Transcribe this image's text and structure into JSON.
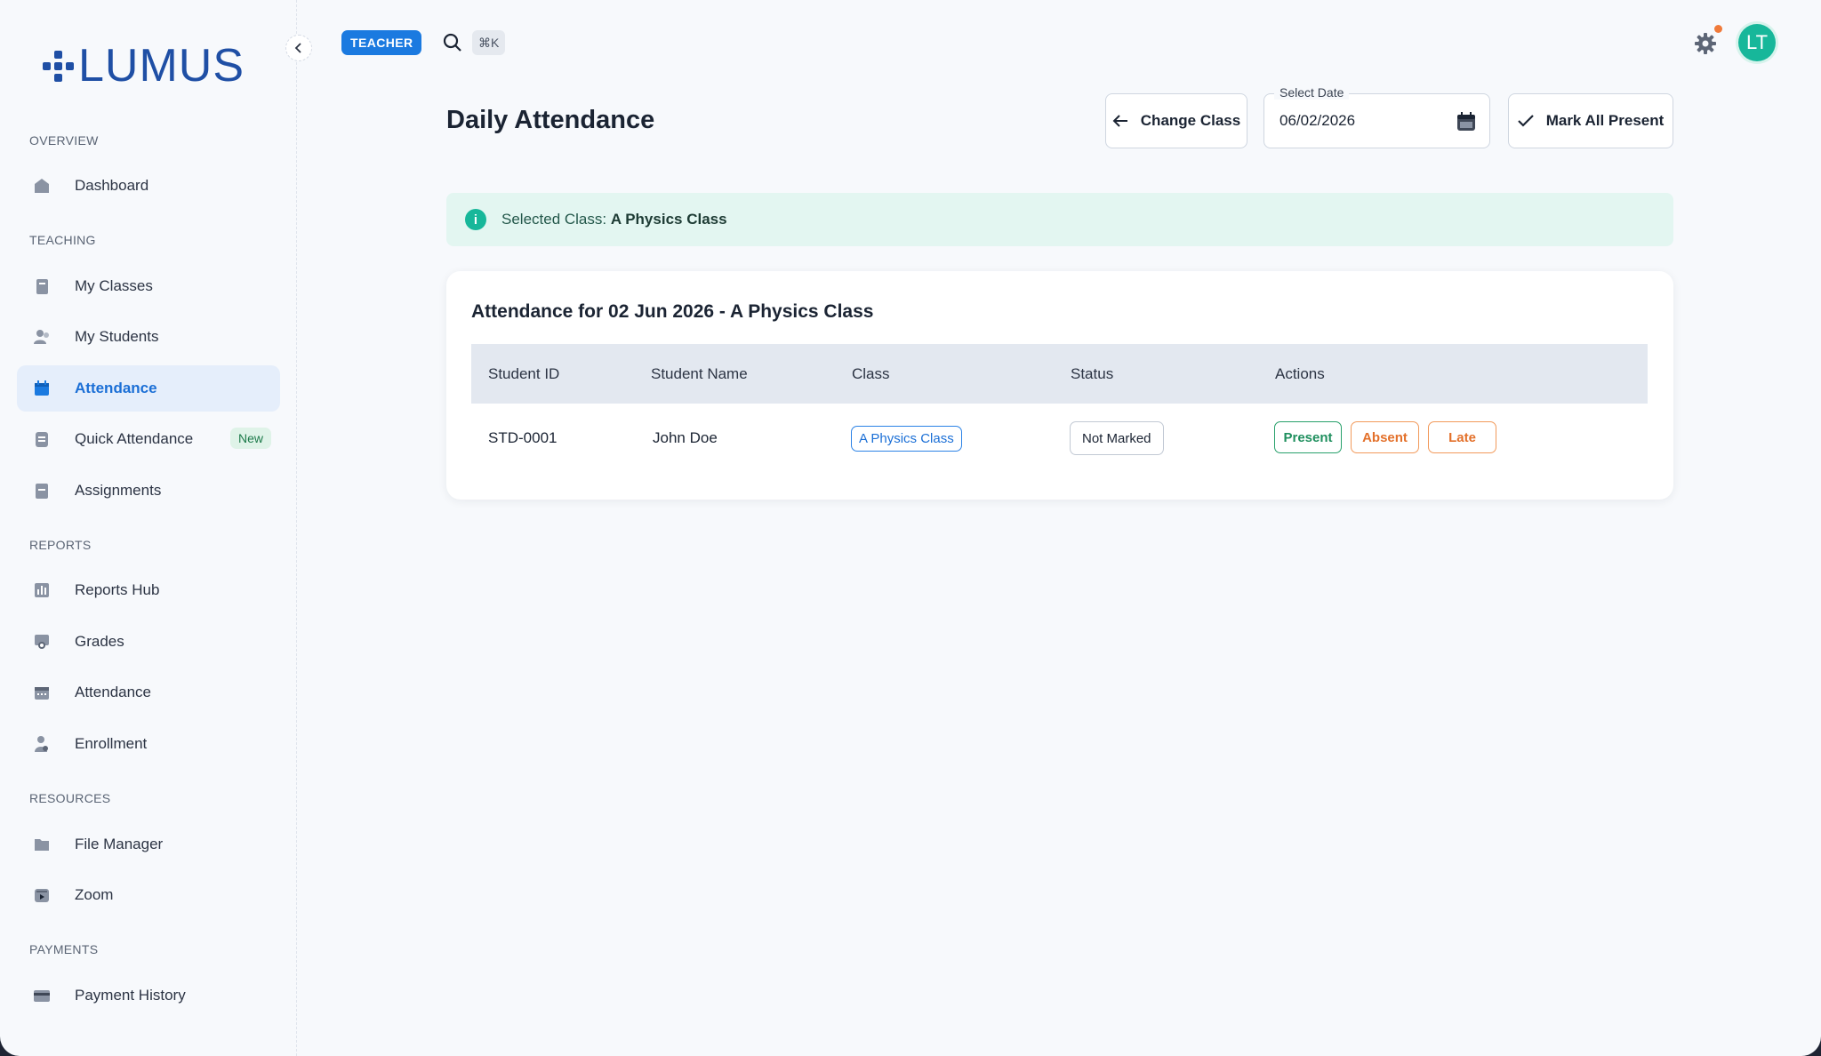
{
  "brand": {
    "name": "LUMUS"
  },
  "topbar": {
    "role_badge": "TEACHER",
    "shortcut": "⌘K",
    "avatar_initials": "LT"
  },
  "sidebar": {
    "sections": [
      {
        "label": "OVERVIEW",
        "items": [
          {
            "label": "Dashboard",
            "icon": "home-icon"
          }
        ]
      },
      {
        "label": "TEACHING",
        "items": [
          {
            "label": "My Classes",
            "icon": "book-icon"
          },
          {
            "label": "My Students",
            "icon": "users-icon"
          },
          {
            "label": "Attendance",
            "icon": "calendar-icon",
            "active": true
          },
          {
            "label": "Quick Attendance",
            "icon": "clipboard-icon",
            "badge": "New"
          },
          {
            "label": "Assignments",
            "icon": "document-icon"
          }
        ]
      },
      {
        "label": "REPORTS",
        "items": [
          {
            "label": "Reports Hub",
            "icon": "chart-icon"
          },
          {
            "label": "Grades",
            "icon": "award-icon"
          },
          {
            "label": "Attendance",
            "icon": "calendar-icon"
          },
          {
            "label": "Enrollment",
            "icon": "user-add-icon"
          }
        ]
      },
      {
        "label": "RESOURCES",
        "items": [
          {
            "label": "File Manager",
            "icon": "folder-icon"
          },
          {
            "label": "Zoom",
            "icon": "video-icon"
          }
        ]
      },
      {
        "label": "PAYMENTS",
        "items": [
          {
            "label": "Payment History",
            "icon": "card-icon"
          }
        ]
      }
    ]
  },
  "page": {
    "title": "Daily Attendance",
    "change_class_label": "Change Class",
    "date_label": "Select Date",
    "date_value": "06/02/2026",
    "mark_all_label": "Mark All Present"
  },
  "alert": {
    "prefix": "Selected Class: ",
    "class_name": "A Physics Class"
  },
  "table": {
    "title": "Attendance for 02 Jun 2026 - A Physics Class",
    "columns": [
      "Student ID",
      "Student Name",
      "Class",
      "Status",
      "Actions"
    ],
    "rows": [
      {
        "student_id": "STD-0001",
        "student_name": "John Doe",
        "class": "A Physics Class",
        "status": "Not Marked"
      }
    ],
    "actions": {
      "present": "Present",
      "absent": "Absent",
      "late": "Late"
    }
  },
  "colors": {
    "primary": "#1b7ae0",
    "brand": "#1f4fa5",
    "success": "#1f8f5e",
    "warning": "#e3702a",
    "teal": "#17b79a"
  }
}
